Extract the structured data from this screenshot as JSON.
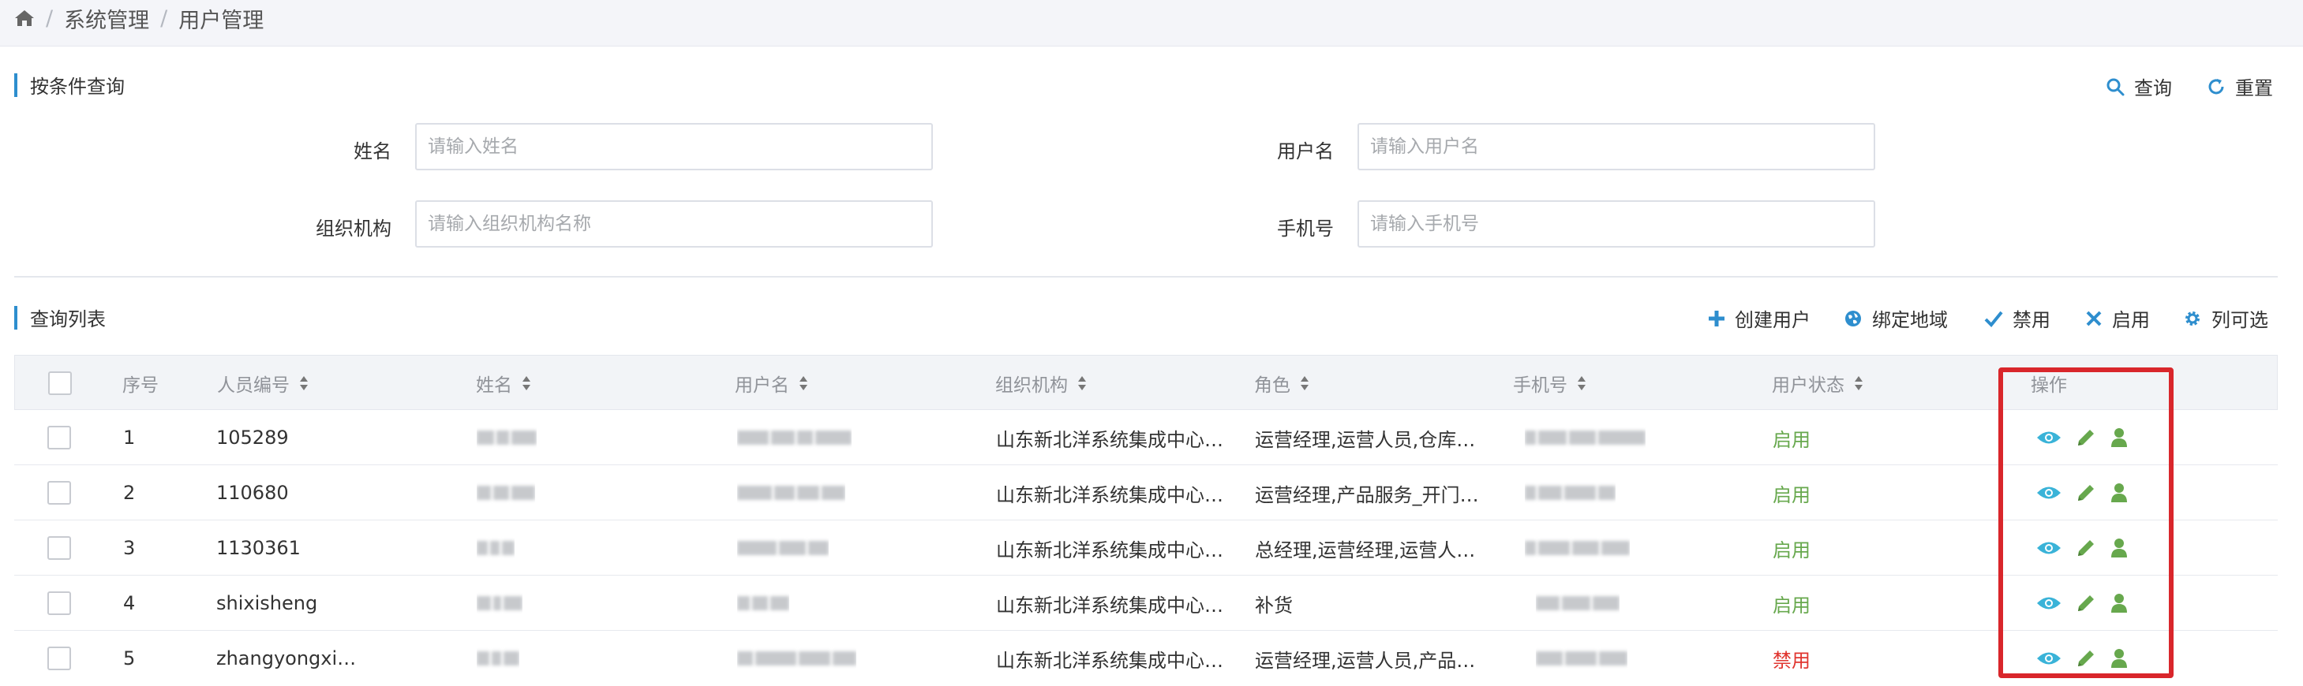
{
  "breadcrumb": {
    "items": [
      "系统管理",
      "用户管理"
    ]
  },
  "query_section": {
    "title": "按条件查询",
    "search_label": "查询",
    "reset_label": "重置",
    "fields": {
      "name": {
        "label": "姓名",
        "placeholder": "请输入姓名"
      },
      "username": {
        "label": "用户名",
        "placeholder": "请输入用户名"
      },
      "org": {
        "label": "组织机构",
        "placeholder": "请输入组织机构名称"
      },
      "phone": {
        "label": "手机号",
        "placeholder": "请输入手机号"
      }
    }
  },
  "list_section": {
    "title": "查询列表",
    "actions": {
      "create": "创建用户",
      "bind_region": "绑定地域",
      "disable": "禁用",
      "enable": "启用",
      "columns": "列可选"
    }
  },
  "table": {
    "headers": {
      "index": "序号",
      "staff_no": "人员编号",
      "name": "姓名",
      "username": "用户名",
      "org": "组织机构",
      "role": "角色",
      "phone": "手机号",
      "status": "用户状态",
      "ops": "操作"
    },
    "rows": [
      {
        "index": "1",
        "staff_no": "105289",
        "org": "山东新北洋系统集成中心…",
        "role": "运营经理,运营人员,仓库…",
        "status": "启用"
      },
      {
        "index": "2",
        "staff_no": "110680",
        "org": "山东新北洋系统集成中心…",
        "role": "运营经理,产品服务_开门…",
        "status": "启用"
      },
      {
        "index": "3",
        "staff_no": "1130361",
        "org": "山东新北洋系统集成中心…",
        "role": "总经理,运营经理,运营人…",
        "status": "启用"
      },
      {
        "index": "4",
        "staff_no": "shixisheng",
        "org": "山东新北洋系统集成中心…",
        "role": "补货",
        "status": "启用"
      },
      {
        "index": "5",
        "staff_no": "zhangyongxi…",
        "org": "山东新北洋系统集成中心…",
        "role": "运营经理,运营人员,产品…",
        "status": "禁用"
      }
    ]
  },
  "colors": {
    "accent": "#2e8ece",
    "status_enabled": "#67a84d",
    "status_disabled": "#e0352f",
    "view_icon": "#3ab3d8",
    "edit_icon": "#67a84d",
    "user_icon": "#67a84d",
    "highlight_box": "#d9262b"
  },
  "icons": {
    "home": "home-icon",
    "search": "search-icon",
    "reset": "refresh-icon",
    "create": "plus-icon",
    "bind_region": "globe-icon",
    "disable": "check-icon",
    "enable": "x-icon",
    "columns": "gear-icon",
    "view": "eye-icon",
    "edit": "pencil-icon",
    "assign": "user-icon"
  }
}
